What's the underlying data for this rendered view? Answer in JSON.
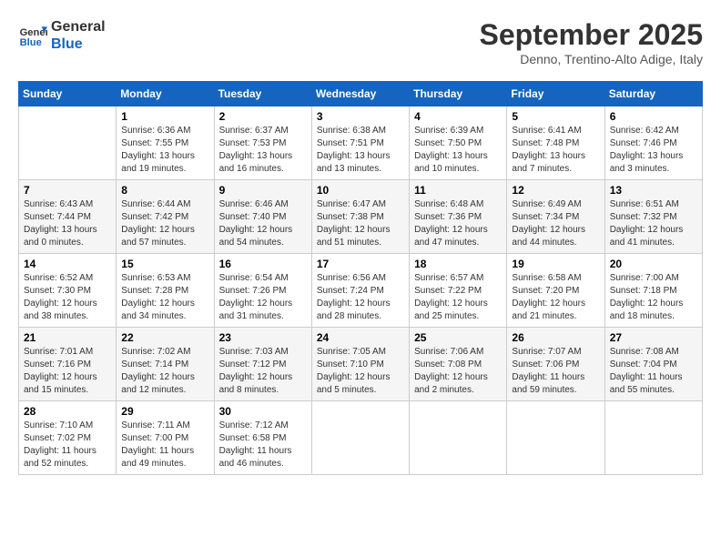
{
  "header": {
    "logo_line1": "General",
    "logo_line2": "Blue",
    "month": "September 2025",
    "location": "Denno, Trentino-Alto Adige, Italy"
  },
  "days_of_week": [
    "Sunday",
    "Monday",
    "Tuesday",
    "Wednesday",
    "Thursday",
    "Friday",
    "Saturday"
  ],
  "weeks": [
    [
      {
        "day": "",
        "info": ""
      },
      {
        "day": "1",
        "info": "Sunrise: 6:36 AM\nSunset: 7:55 PM\nDaylight: 13 hours\nand 19 minutes."
      },
      {
        "day": "2",
        "info": "Sunrise: 6:37 AM\nSunset: 7:53 PM\nDaylight: 13 hours\nand 16 minutes."
      },
      {
        "day": "3",
        "info": "Sunrise: 6:38 AM\nSunset: 7:51 PM\nDaylight: 13 hours\nand 13 minutes."
      },
      {
        "day": "4",
        "info": "Sunrise: 6:39 AM\nSunset: 7:50 PM\nDaylight: 13 hours\nand 10 minutes."
      },
      {
        "day": "5",
        "info": "Sunrise: 6:41 AM\nSunset: 7:48 PM\nDaylight: 13 hours\nand 7 minutes."
      },
      {
        "day": "6",
        "info": "Sunrise: 6:42 AM\nSunset: 7:46 PM\nDaylight: 13 hours\nand 3 minutes."
      }
    ],
    [
      {
        "day": "7",
        "info": "Sunrise: 6:43 AM\nSunset: 7:44 PM\nDaylight: 13 hours\nand 0 minutes."
      },
      {
        "day": "8",
        "info": "Sunrise: 6:44 AM\nSunset: 7:42 PM\nDaylight: 12 hours\nand 57 minutes."
      },
      {
        "day": "9",
        "info": "Sunrise: 6:46 AM\nSunset: 7:40 PM\nDaylight: 12 hours\nand 54 minutes."
      },
      {
        "day": "10",
        "info": "Sunrise: 6:47 AM\nSunset: 7:38 PM\nDaylight: 12 hours\nand 51 minutes."
      },
      {
        "day": "11",
        "info": "Sunrise: 6:48 AM\nSunset: 7:36 PM\nDaylight: 12 hours\nand 47 minutes."
      },
      {
        "day": "12",
        "info": "Sunrise: 6:49 AM\nSunset: 7:34 PM\nDaylight: 12 hours\nand 44 minutes."
      },
      {
        "day": "13",
        "info": "Sunrise: 6:51 AM\nSunset: 7:32 PM\nDaylight: 12 hours\nand 41 minutes."
      }
    ],
    [
      {
        "day": "14",
        "info": "Sunrise: 6:52 AM\nSunset: 7:30 PM\nDaylight: 12 hours\nand 38 minutes."
      },
      {
        "day": "15",
        "info": "Sunrise: 6:53 AM\nSunset: 7:28 PM\nDaylight: 12 hours\nand 34 minutes."
      },
      {
        "day": "16",
        "info": "Sunrise: 6:54 AM\nSunset: 7:26 PM\nDaylight: 12 hours\nand 31 minutes."
      },
      {
        "day": "17",
        "info": "Sunrise: 6:56 AM\nSunset: 7:24 PM\nDaylight: 12 hours\nand 28 minutes."
      },
      {
        "day": "18",
        "info": "Sunrise: 6:57 AM\nSunset: 7:22 PM\nDaylight: 12 hours\nand 25 minutes."
      },
      {
        "day": "19",
        "info": "Sunrise: 6:58 AM\nSunset: 7:20 PM\nDaylight: 12 hours\nand 21 minutes."
      },
      {
        "day": "20",
        "info": "Sunrise: 7:00 AM\nSunset: 7:18 PM\nDaylight: 12 hours\nand 18 minutes."
      }
    ],
    [
      {
        "day": "21",
        "info": "Sunrise: 7:01 AM\nSunset: 7:16 PM\nDaylight: 12 hours\nand 15 minutes."
      },
      {
        "day": "22",
        "info": "Sunrise: 7:02 AM\nSunset: 7:14 PM\nDaylight: 12 hours\nand 12 minutes."
      },
      {
        "day": "23",
        "info": "Sunrise: 7:03 AM\nSunset: 7:12 PM\nDaylight: 12 hours\nand 8 minutes."
      },
      {
        "day": "24",
        "info": "Sunrise: 7:05 AM\nSunset: 7:10 PM\nDaylight: 12 hours\nand 5 minutes."
      },
      {
        "day": "25",
        "info": "Sunrise: 7:06 AM\nSunset: 7:08 PM\nDaylight: 12 hours\nand 2 minutes."
      },
      {
        "day": "26",
        "info": "Sunrise: 7:07 AM\nSunset: 7:06 PM\nDaylight: 11 hours\nand 59 minutes."
      },
      {
        "day": "27",
        "info": "Sunrise: 7:08 AM\nSunset: 7:04 PM\nDaylight: 11 hours\nand 55 minutes."
      }
    ],
    [
      {
        "day": "28",
        "info": "Sunrise: 7:10 AM\nSunset: 7:02 PM\nDaylight: 11 hours\nand 52 minutes."
      },
      {
        "day": "29",
        "info": "Sunrise: 7:11 AM\nSunset: 7:00 PM\nDaylight: 11 hours\nand 49 minutes."
      },
      {
        "day": "30",
        "info": "Sunrise: 7:12 AM\nSunset: 6:58 PM\nDaylight: 11 hours\nand 46 minutes."
      },
      {
        "day": "",
        "info": ""
      },
      {
        "day": "",
        "info": ""
      },
      {
        "day": "",
        "info": ""
      },
      {
        "day": "",
        "info": ""
      }
    ]
  ]
}
